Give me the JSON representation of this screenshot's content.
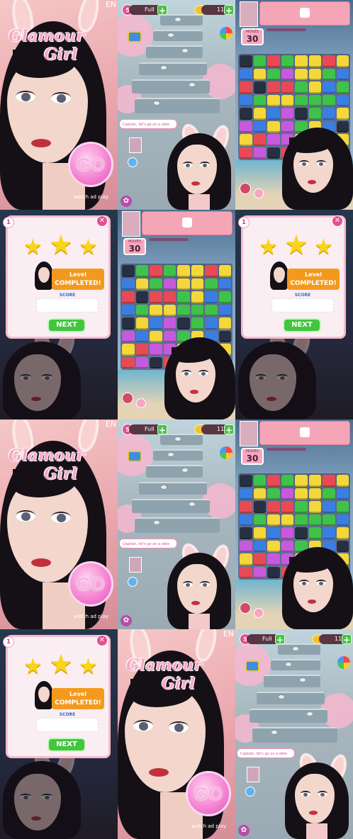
{
  "splash": {
    "lang": "EN",
    "logo_line1": "Glamour",
    "logo_line2": "Girl",
    "go_label": "GO",
    "watch_hint": "watch ad play"
  },
  "map": {
    "lives_count": "5",
    "lives_status": "Full",
    "coins_count": "11",
    "chat_bubble": "Captain, let's go on a date"
  },
  "puzzle": {
    "moves_label": "MOVES",
    "moves_value": "30"
  },
  "complete": {
    "level_number": "1",
    "level_text_line1": "Level",
    "level_text_line2": "COMPLETED!",
    "score_label": "SCORE",
    "next_label": "NEXT"
  },
  "colors": {
    "accent": "#e34f8f",
    "next_green": "#41c63d",
    "banner_orange": "#f39a1e"
  },
  "board_rows": [
    [
      "k",
      "g",
      "r",
      "g",
      "y",
      "y",
      "r",
      "y"
    ],
    [
      "b",
      "y",
      "g",
      "p",
      "y",
      "y",
      "g",
      "b"
    ],
    [
      "r",
      "k",
      "r",
      "r",
      "g",
      "y",
      "b",
      "g"
    ],
    [
      "b",
      "g",
      "y",
      "y",
      "g",
      "g",
      "g",
      "b"
    ],
    [
      "k",
      "y",
      "b",
      "p",
      "k",
      "g",
      "b",
      "y"
    ],
    [
      "p",
      "b",
      "y",
      "p",
      "g",
      "y",
      "b",
      "k"
    ],
    [
      "y",
      "r",
      "p",
      "p",
      "y",
      "p",
      "p",
      "y"
    ],
    [
      "r",
      "p",
      "k",
      "r",
      "p",
      "p",
      "p",
      "r"
    ]
  ]
}
